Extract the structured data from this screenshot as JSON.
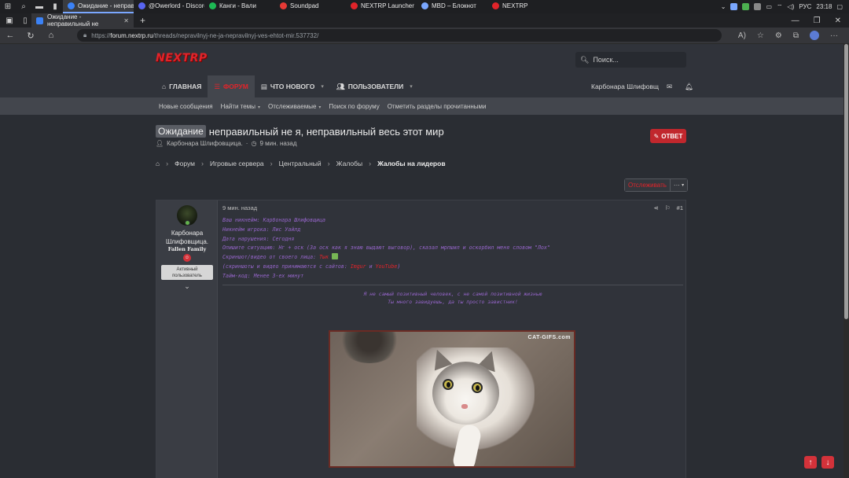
{
  "taskbar": {
    "apps": [
      {
        "label": "Ожидание - неправи...",
        "color": "#3b82f6",
        "active": true
      },
      {
        "label": "@Owerlord - Discord",
        "color": "#5865f2",
        "active": false
      },
      {
        "label": "Канги - Вали",
        "color": "#1db954",
        "active": false
      },
      {
        "label": "Soundpad",
        "color": "#e53935",
        "active": false
      },
      {
        "label": "NEXTRP Launcher",
        "color": "#e0242a",
        "active": false
      },
      {
        "label": "MBD – Блокнот",
        "color": "#7aa7ff",
        "active": false
      },
      {
        "label": "NEXTRP",
        "color": "#e0242a",
        "active": false
      }
    ],
    "lang": "РУС",
    "time": "23:18"
  },
  "browser": {
    "tab_title": "Ожидание - неправильный не",
    "url_prefix": "https://",
    "url_host": "forum.nextrp.ru",
    "url_path": "/threads/nepravilnyj-ne-ja-nepravilnyj-ves-ehtot-mir.537732/"
  },
  "site": {
    "logo": "NEXTRP",
    "search_placeholder": "Поиск...",
    "nav": [
      {
        "label": "Главная",
        "icon": "home-icon",
        "active": false,
        "dropdown": false
      },
      {
        "label": "Форум",
        "icon": "forum-icon",
        "active": true,
        "dropdown": false
      },
      {
        "label": "Что нового",
        "icon": "news-icon",
        "active": false,
        "dropdown": true
      },
      {
        "label": "Пользователи",
        "icon": "users-icon",
        "active": false,
        "dropdown": true
      }
    ],
    "username": "Карбонара Шлифовщ",
    "subnav": [
      "Новые сообщения",
      "Найти темы",
      "Отслеживаемые",
      "Поиск по форуму",
      "Отметить разделы прочитанными"
    ]
  },
  "thread": {
    "prefix": "Ожидание",
    "title": "неправильный не я, неправильный весь этот мир",
    "author": "Карбонара Шлифовщица.",
    "time": "9 мин. назад",
    "reply_label": "ОТВЕТ",
    "breadcrumb": [
      "Форум",
      "Игровые сервера",
      "Центральный",
      "Жалобы",
      "Жалобы на лидеров"
    ],
    "watch_label": "Отслеживать",
    "more_label": "···"
  },
  "post": {
    "user": {
      "name_line1": "Карбонара",
      "name_line2": "Шлифовщица.",
      "title": "Fallen Family",
      "rank_line1": "Активный",
      "rank_line2": "пользователь"
    },
    "time": "9 мин. назад",
    "number": "#1",
    "lines": [
      "Ваш никнейм: Карбонара Шлифовщица",
      "Никнейм игрока: Лис Уайлд",
      "Дата нарушения: Сегодня",
      "Опишите ситуацию: Нг + оск (За оск как я знаю выдают выговор), сказал мрпшил и оскорбил меня словом \"Лох\""
    ],
    "proof_prefix": "Скриншот/видео от своего лица: ",
    "proof_link": "Тык",
    "hosting_prefix": "(скриншоты и видео принимаются с сайтов: ",
    "hosting_link1": "Imgur",
    "hosting_and": " и ",
    "hosting_link2": "YouTube",
    "hosting_suffix": ")",
    "timecode": "Тайм-код: Менее 3-ех минут",
    "quote_line1": "Я не самый позитивный человек, с не самой позитивной жизнью",
    "quote_line2": "Ты много завидуешь, да ты просто завистник!",
    "gif_watermark": "CAT-GIFS.com"
  }
}
